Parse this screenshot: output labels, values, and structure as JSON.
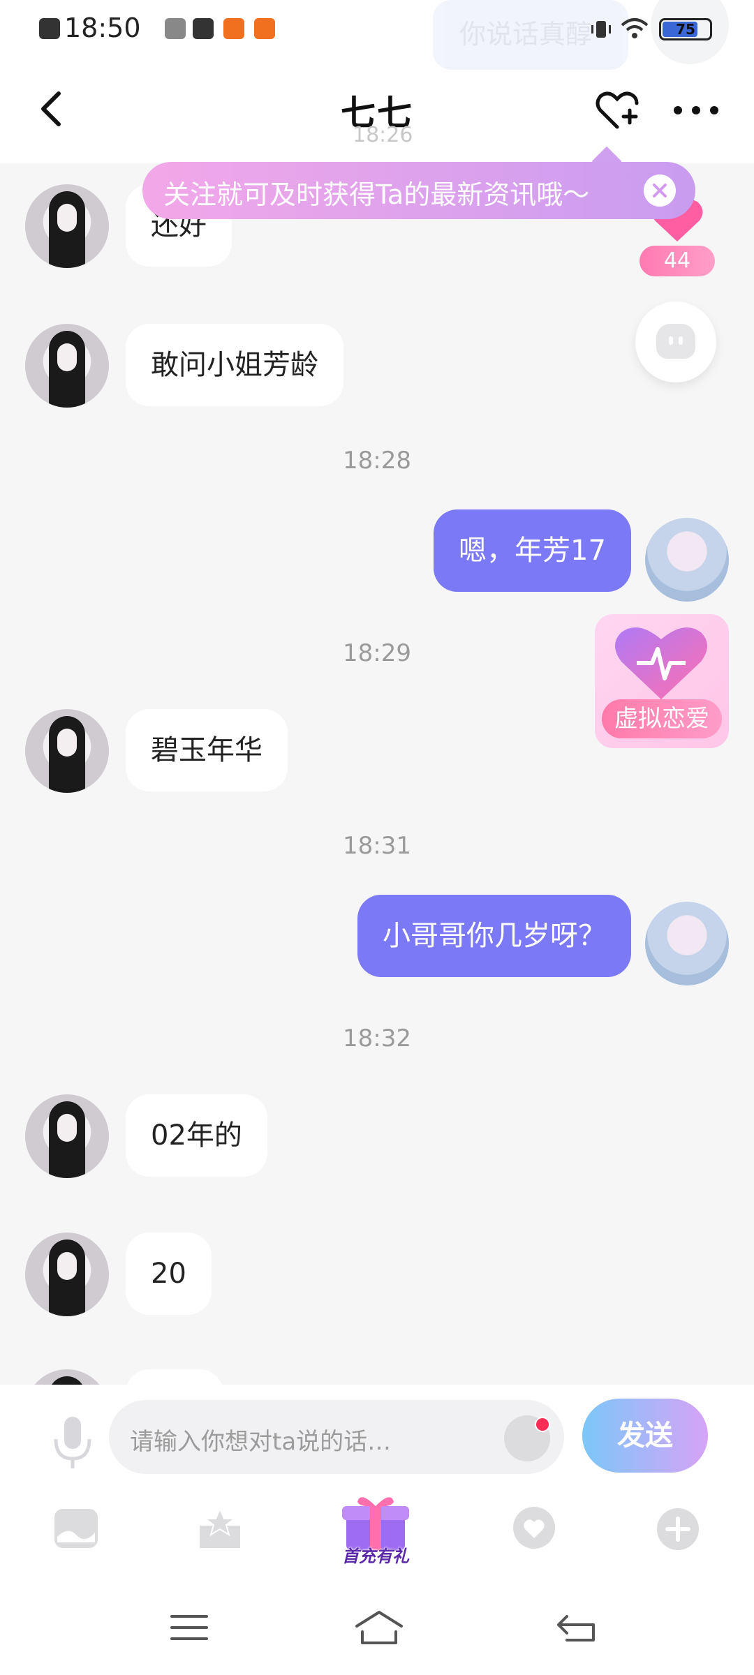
{
  "status_bar": {
    "time": "18:50",
    "battery": "75",
    "battery_level": 0.75
  },
  "ghost_notice": {
    "text": "你说话真醇"
  },
  "header": {
    "title": "七七",
    "ghost_time": "18:26"
  },
  "tooltip": {
    "text": "关注就可及时获得Ta的最新资讯哦～"
  },
  "gift_widget": {
    "count": "44"
  },
  "love_card": {
    "label": "虚拟恋爱"
  },
  "messages": [
    {
      "side": "left",
      "text": "还好"
    },
    {
      "side": "left",
      "text": "敢问小姐芳龄"
    },
    {
      "time": "18:28"
    },
    {
      "side": "right",
      "text": "嗯，年芳17"
    },
    {
      "time": "18:29"
    },
    {
      "side": "left",
      "text": "碧玉年华"
    },
    {
      "time": "18:31"
    },
    {
      "side": "right",
      "text": "小哥哥你几岁呀？"
    },
    {
      "time": "18:32"
    },
    {
      "side": "left",
      "text": "02年的"
    },
    {
      "side": "left",
      "text": "20"
    }
  ],
  "input": {
    "placeholder": "请输入你想对ta说的话…",
    "send_label": "发送"
  },
  "toolbar": {
    "gift_label": "首充有礼"
  },
  "colors": {
    "bubble_right": "#7b79f6",
    "background": "#f6f6f7",
    "accent_pink": "#ff7aaa"
  }
}
